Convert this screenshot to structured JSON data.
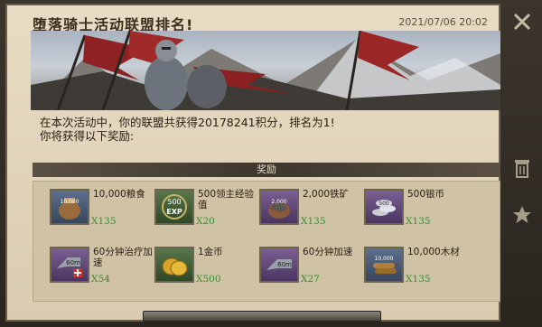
{
  "header": {
    "title": "堕落骑士活动联盟排名!",
    "date": "2021/07/06 20:02"
  },
  "message": {
    "line1": "在本次活动中，你的联盟共获得20178241积分，排名为1!",
    "line2": "你将获得以下奖励:"
  },
  "rewards_header": "奖励",
  "rewards": [
    {
      "name": "10,000粮食",
      "qty": "X135",
      "icon": "food-sack-icon",
      "badge": "10,000"
    },
    {
      "name": "500领主经验值",
      "qty": "X20",
      "icon": "exp-icon",
      "badge": "500"
    },
    {
      "name": "2,000铁矿",
      "qty": "X135",
      "icon": "iron-ore-icon",
      "badge": "2,000"
    },
    {
      "name": "500银币",
      "qty": "X135",
      "icon": "silver-coins-icon",
      "badge": "500"
    },
    {
      "name": "60分钟治疗加速",
      "qty": "X54",
      "icon": "heal-speedup-icon",
      "badge": "60m"
    },
    {
      "name": "1金币",
      "qty": "X500",
      "icon": "gold-coin-icon",
      "badge": ""
    },
    {
      "name": "60分钟加速",
      "qty": "X27",
      "icon": "speedup-icon",
      "badge": "60m"
    },
    {
      "name": "10,000木材",
      "qty": "X135",
      "icon": "wood-icon",
      "badge": "10,000"
    }
  ],
  "exp_label": "EXP",
  "colors": {
    "accent": "#2f8f2f",
    "panel": "#e8dcc4"
  }
}
